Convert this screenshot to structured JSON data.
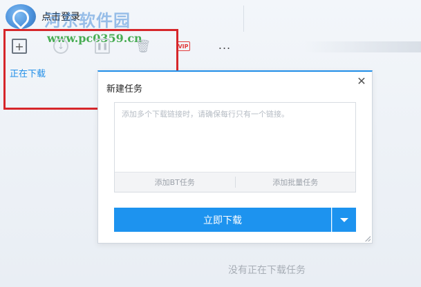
{
  "header": {
    "login_label": "点击登录",
    "watermark_text": "河东软件园",
    "watermark_url": "www.pc0359.cn"
  },
  "toolbar": {
    "add_icon": "plus-square-icon",
    "download_icon": "download-circle-icon",
    "pause_icon": "pause-square-icon",
    "delete_icon": "trash-icon",
    "vip_label": "VIP",
    "more_label": "...",
    "highlight_color": "#d6262a"
  },
  "tabs": {
    "downloading_label": "正在下载"
  },
  "main": {
    "empty_message": "没有正在下载任务"
  },
  "dialog": {
    "title": "新建任务",
    "close_label": "✕",
    "link_placeholder": "添加多个下载链接时，请确保每行只有一个链接。",
    "link_value": "",
    "add_bt_label": "添加BT任务",
    "add_batch_label": "添加批量任务",
    "download_now_label": "立即下载",
    "accent_color": "#1d93ef"
  }
}
